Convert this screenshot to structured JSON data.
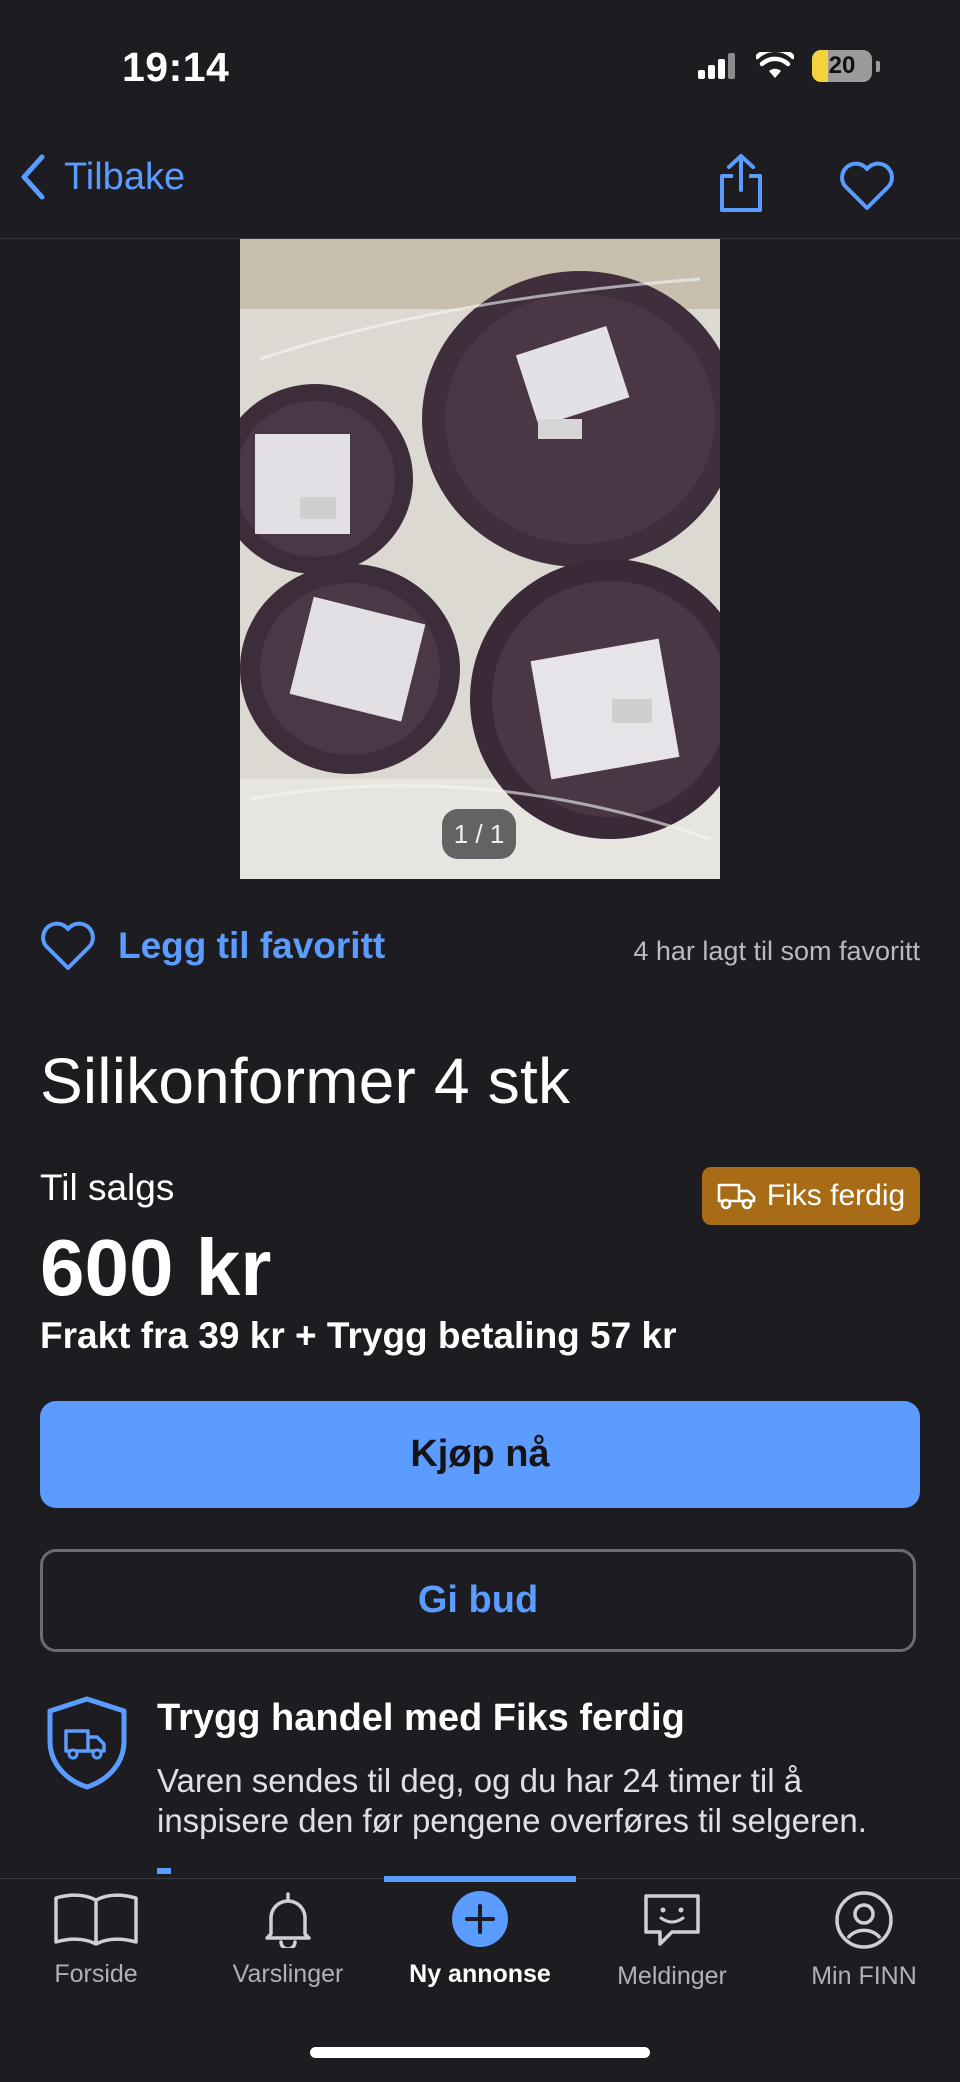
{
  "status_bar": {
    "time": "19:14",
    "battery": "20"
  },
  "nav": {
    "back_label": "Tilbake"
  },
  "gallery": {
    "counter": "1 / 1"
  },
  "favorite": {
    "label": "Legg til favoritt",
    "count_text": "4 har lagt til som favoritt"
  },
  "listing": {
    "title": "Silikonformer 4 stk",
    "sale_label": "Til salgs",
    "badge": "Fiks ferdig",
    "price": "600 kr",
    "shipping": "Frakt fra 39 kr + Trygg betaling 57 kr"
  },
  "actions": {
    "buy_label": "Kjøp nå",
    "bid_label": "Gi bud"
  },
  "safe_trade": {
    "title": "Trygg handel med Fiks ferdig",
    "body": "Varen sendes til deg, og du har 24 timer til å inspisere den før pengene overføres til selgeren."
  },
  "tabs": [
    {
      "label": "Forside",
      "icon": "book-icon"
    },
    {
      "label": "Varslinger",
      "icon": "bell-icon"
    },
    {
      "label": "Ny annonse",
      "icon": "plus-circle-icon"
    },
    {
      "label": "Meldinger",
      "icon": "chat-icon"
    },
    {
      "label": "Min FINN",
      "icon": "profile-icon"
    }
  ],
  "colors": {
    "accent": "#5c9bff",
    "background": "#1c1c21",
    "badge": "#a86b16"
  }
}
